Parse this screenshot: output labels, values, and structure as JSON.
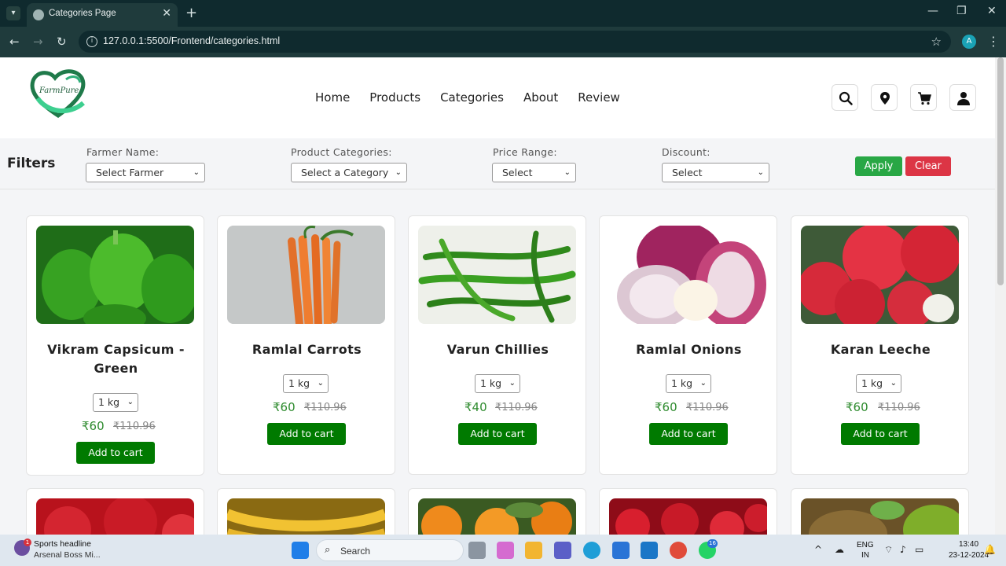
{
  "browser": {
    "tab_title": "Categories Page",
    "url": "127.0.0.1:5500/Frontend/categories.html",
    "profile_initial": "A"
  },
  "site": {
    "logo_text": "FarmPure",
    "nav": [
      "Home",
      "Products",
      "Categories",
      "About",
      "Review"
    ],
    "header_icons": [
      "search-icon",
      "location-pin-icon",
      "cart-icon",
      "user-icon"
    ]
  },
  "filters": {
    "title": "Filters",
    "farmer_label": "Farmer Name:",
    "farmer_value": "Select Farmer",
    "category_label": "Product Categories:",
    "category_value": "Select a Category",
    "price_label": "Price Range:",
    "price_value": "Select",
    "discount_label": "Discount:",
    "discount_value": "Select",
    "apply_label": "Apply",
    "clear_label": "Clear"
  },
  "products": [
    {
      "name": "Vikram Capsicum - Green",
      "qty": "1 kg",
      "price": "₹60",
      "old_price": "₹110.96",
      "button": "Add to cart",
      "image": "green-capsicum"
    },
    {
      "name": "Ramlal Carrots",
      "qty": "1 kg",
      "price": "₹60",
      "old_price": "₹110.96",
      "button": "Add to cart",
      "image": "carrots"
    },
    {
      "name": "Varun Chillies",
      "qty": "1 kg",
      "price": "₹40",
      "old_price": "₹110.96",
      "button": "Add to cart",
      "image": "green-chillies"
    },
    {
      "name": "Ramlal Onions",
      "qty": "1 kg",
      "price": "₹60",
      "old_price": "₹110.96",
      "button": "Add to cart",
      "image": "red-onions"
    },
    {
      "name": "Karan Leeche",
      "qty": "1 kg",
      "price": "₹60",
      "old_price": "₹110.96",
      "button": "Add to cart",
      "image": "lychee"
    }
  ],
  "taskbar": {
    "news_badge": "1",
    "news_headline": "Sports headline",
    "news_sub": "Arsenal Boss Mi...",
    "search_label": "Search",
    "whatsapp_badge": "16",
    "lang_line1": "ENG",
    "lang_line2": "IN",
    "time": "13:40",
    "date": "23-12-2024"
  }
}
